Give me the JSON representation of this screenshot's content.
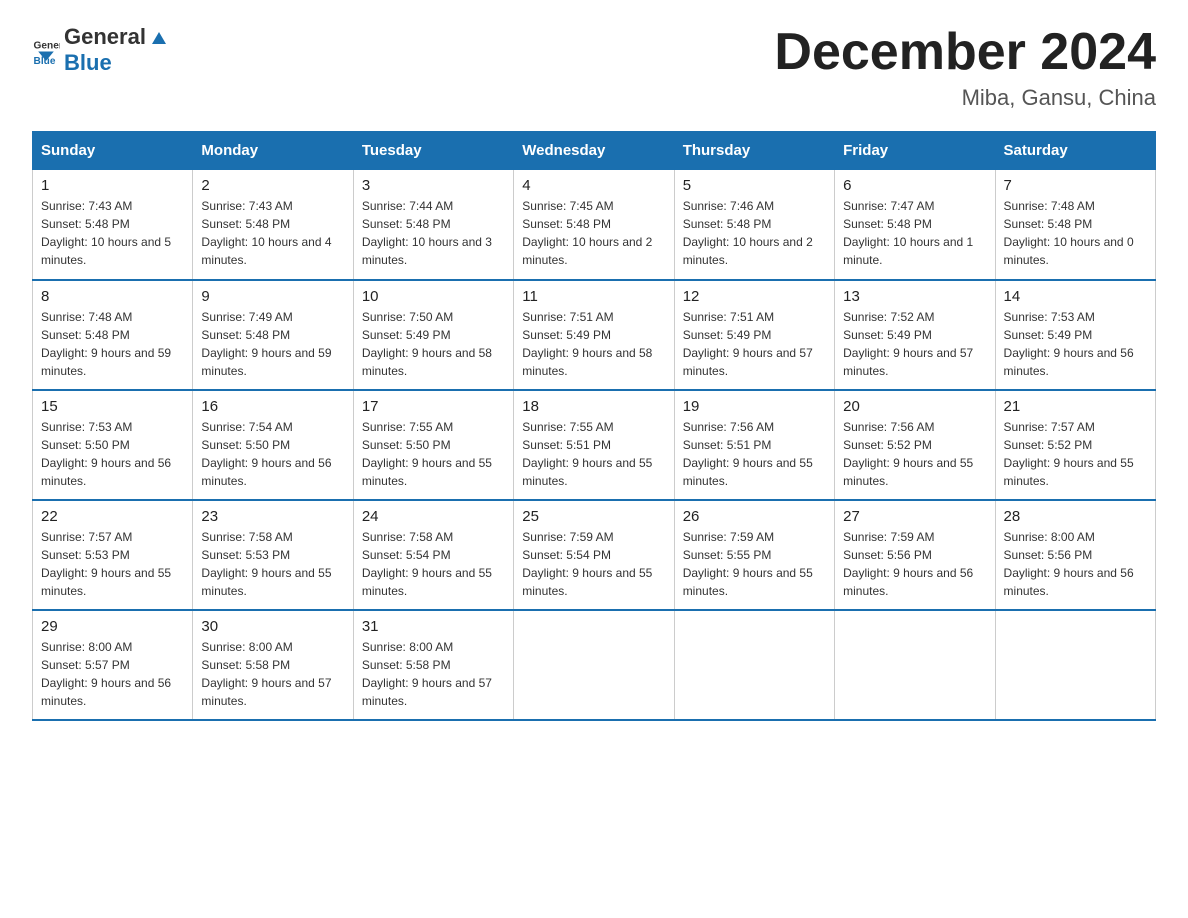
{
  "header": {
    "logo_general": "General",
    "logo_blue": "Blue",
    "month_title": "December 2024",
    "location": "Miba, Gansu, China"
  },
  "days_of_week": [
    "Sunday",
    "Monday",
    "Tuesday",
    "Wednesday",
    "Thursday",
    "Friday",
    "Saturday"
  ],
  "weeks": [
    [
      {
        "day": "1",
        "sunrise": "7:43 AM",
        "sunset": "5:48 PM",
        "daylight": "10 hours and 5 minutes."
      },
      {
        "day": "2",
        "sunrise": "7:43 AM",
        "sunset": "5:48 PM",
        "daylight": "10 hours and 4 minutes."
      },
      {
        "day": "3",
        "sunrise": "7:44 AM",
        "sunset": "5:48 PM",
        "daylight": "10 hours and 3 minutes."
      },
      {
        "day": "4",
        "sunrise": "7:45 AM",
        "sunset": "5:48 PM",
        "daylight": "10 hours and 2 minutes."
      },
      {
        "day": "5",
        "sunrise": "7:46 AM",
        "sunset": "5:48 PM",
        "daylight": "10 hours and 2 minutes."
      },
      {
        "day": "6",
        "sunrise": "7:47 AM",
        "sunset": "5:48 PM",
        "daylight": "10 hours and 1 minute."
      },
      {
        "day": "7",
        "sunrise": "7:48 AM",
        "sunset": "5:48 PM",
        "daylight": "10 hours and 0 minutes."
      }
    ],
    [
      {
        "day": "8",
        "sunrise": "7:48 AM",
        "sunset": "5:48 PM",
        "daylight": "9 hours and 59 minutes."
      },
      {
        "day": "9",
        "sunrise": "7:49 AM",
        "sunset": "5:48 PM",
        "daylight": "9 hours and 59 minutes."
      },
      {
        "day": "10",
        "sunrise": "7:50 AM",
        "sunset": "5:49 PM",
        "daylight": "9 hours and 58 minutes."
      },
      {
        "day": "11",
        "sunrise": "7:51 AM",
        "sunset": "5:49 PM",
        "daylight": "9 hours and 58 minutes."
      },
      {
        "day": "12",
        "sunrise": "7:51 AM",
        "sunset": "5:49 PM",
        "daylight": "9 hours and 57 minutes."
      },
      {
        "day": "13",
        "sunrise": "7:52 AM",
        "sunset": "5:49 PM",
        "daylight": "9 hours and 57 minutes."
      },
      {
        "day": "14",
        "sunrise": "7:53 AM",
        "sunset": "5:49 PM",
        "daylight": "9 hours and 56 minutes."
      }
    ],
    [
      {
        "day": "15",
        "sunrise": "7:53 AM",
        "sunset": "5:50 PM",
        "daylight": "9 hours and 56 minutes."
      },
      {
        "day": "16",
        "sunrise": "7:54 AM",
        "sunset": "5:50 PM",
        "daylight": "9 hours and 56 minutes."
      },
      {
        "day": "17",
        "sunrise": "7:55 AM",
        "sunset": "5:50 PM",
        "daylight": "9 hours and 55 minutes."
      },
      {
        "day": "18",
        "sunrise": "7:55 AM",
        "sunset": "5:51 PM",
        "daylight": "9 hours and 55 minutes."
      },
      {
        "day": "19",
        "sunrise": "7:56 AM",
        "sunset": "5:51 PM",
        "daylight": "9 hours and 55 minutes."
      },
      {
        "day": "20",
        "sunrise": "7:56 AM",
        "sunset": "5:52 PM",
        "daylight": "9 hours and 55 minutes."
      },
      {
        "day": "21",
        "sunrise": "7:57 AM",
        "sunset": "5:52 PM",
        "daylight": "9 hours and 55 minutes."
      }
    ],
    [
      {
        "day": "22",
        "sunrise": "7:57 AM",
        "sunset": "5:53 PM",
        "daylight": "9 hours and 55 minutes."
      },
      {
        "day": "23",
        "sunrise": "7:58 AM",
        "sunset": "5:53 PM",
        "daylight": "9 hours and 55 minutes."
      },
      {
        "day": "24",
        "sunrise": "7:58 AM",
        "sunset": "5:54 PM",
        "daylight": "9 hours and 55 minutes."
      },
      {
        "day": "25",
        "sunrise": "7:59 AM",
        "sunset": "5:54 PM",
        "daylight": "9 hours and 55 minutes."
      },
      {
        "day": "26",
        "sunrise": "7:59 AM",
        "sunset": "5:55 PM",
        "daylight": "9 hours and 55 minutes."
      },
      {
        "day": "27",
        "sunrise": "7:59 AM",
        "sunset": "5:56 PM",
        "daylight": "9 hours and 56 minutes."
      },
      {
        "day": "28",
        "sunrise": "8:00 AM",
        "sunset": "5:56 PM",
        "daylight": "9 hours and 56 minutes."
      }
    ],
    [
      {
        "day": "29",
        "sunrise": "8:00 AM",
        "sunset": "5:57 PM",
        "daylight": "9 hours and 56 minutes."
      },
      {
        "day": "30",
        "sunrise": "8:00 AM",
        "sunset": "5:58 PM",
        "daylight": "9 hours and 57 minutes."
      },
      {
        "day": "31",
        "sunrise": "8:00 AM",
        "sunset": "5:58 PM",
        "daylight": "9 hours and 57 minutes."
      },
      null,
      null,
      null,
      null
    ]
  ]
}
